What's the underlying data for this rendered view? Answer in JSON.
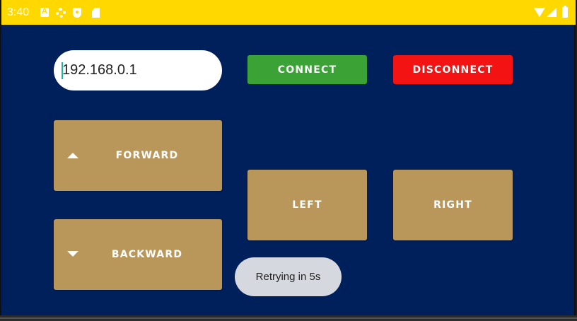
{
  "status_bar": {
    "time": "3:40",
    "icons": [
      "a-icon",
      "gear-icon",
      "shield-icon",
      "sd-card-icon",
      "wifi-icon",
      "signal-icon",
      "battery-icon"
    ],
    "color": "#ffd800"
  },
  "connection": {
    "ip_value": "192.168.0.1",
    "connect_label": "CONNECT",
    "disconnect_label": "DISCONNECT",
    "connect_color": "#3ba235",
    "disconnect_color": "#f31313"
  },
  "controls": {
    "forward_label": "FORWARD",
    "backward_label": "BACKWARD",
    "left_label": "LEFT",
    "right_label": "RIGHT",
    "button_color": "#b9975b"
  },
  "toast": {
    "message": "Retrying in 5s"
  },
  "theme": {
    "background": "#00205b"
  }
}
